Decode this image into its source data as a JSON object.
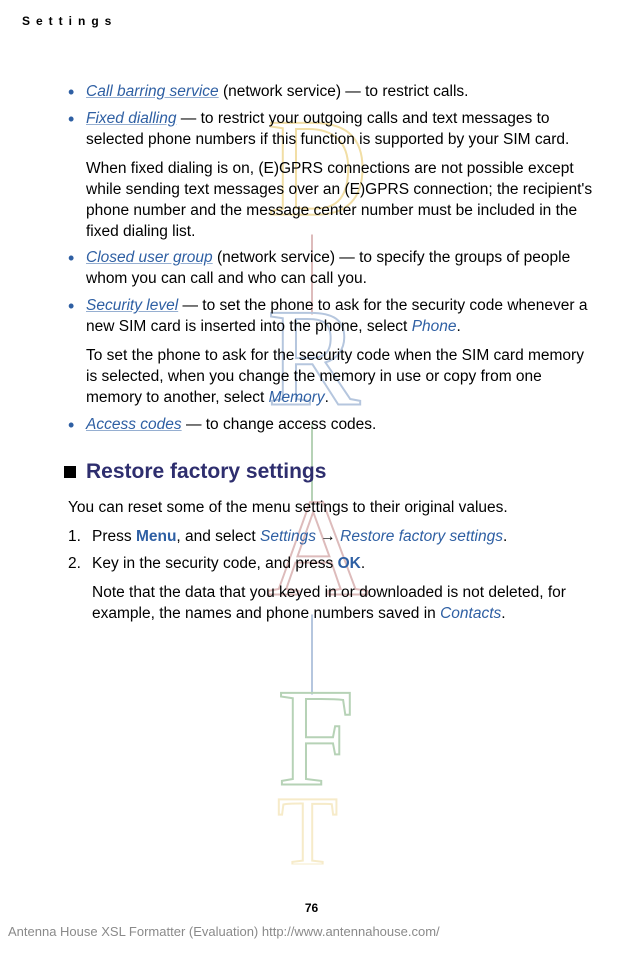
{
  "header": {
    "title": "Settings"
  },
  "bullets": [
    {
      "term": "Call barring service",
      "term_suffix": " (network service) — to restrict calls.",
      "paragraphs": []
    },
    {
      "term": "Fixed dialling",
      "term_suffix": " — to restrict your outgoing calls and text messages to selected phone numbers if this function is supported by your SIM card.",
      "paragraphs": [
        "When fixed dialing is on, (E)GPRS connections are not possible except while sending text messages over an (E)GPRS connection; the recipient's phone number and the message center number must be included in the fixed dialing list."
      ]
    },
    {
      "term": "Closed user group",
      "term_suffix": " (network service) — to specify the groups of people whom you can call and who can call you.",
      "paragraphs": []
    },
    {
      "term": "Security level",
      "term_suffix": " — to set the phone to ask for the security code whenever a new SIM card is inserted into the phone, select ",
      "term_end_link": "Phone",
      "term_end_period": ".",
      "paragraphs_rich": [
        {
          "pre": "To set the phone to ask for the security code when the SIM card memory is selected, when you change the memory in use or copy from one memory to another, select ",
          "link": "Memory",
          "post": "."
        }
      ]
    },
    {
      "term": "Access codes",
      "term_suffix": " — to change access codes.",
      "paragraphs": []
    }
  ],
  "section": {
    "title": "Restore factory settings",
    "intro": "You can reset some of the menu settings to their original values.",
    "steps": [
      {
        "pre": "Press ",
        "bold1": "Menu",
        "mid1": ", and select ",
        "link1": "Settings",
        "arrow": " → ",
        "link2": "Restore factory settings",
        "post": "."
      },
      {
        "pre": "Key in the security code, and press ",
        "bold1": "OK",
        "post": ".",
        "note_pre": "Note that the data that you keyed in or downloaded is not deleted, for example, the names and phone numbers saved in ",
        "note_link": "Contacts",
        "note_post": "."
      }
    ]
  },
  "page_number": "76",
  "footer": "Antenna House XSL Formatter (Evaluation)  http://www.antennahouse.com/"
}
